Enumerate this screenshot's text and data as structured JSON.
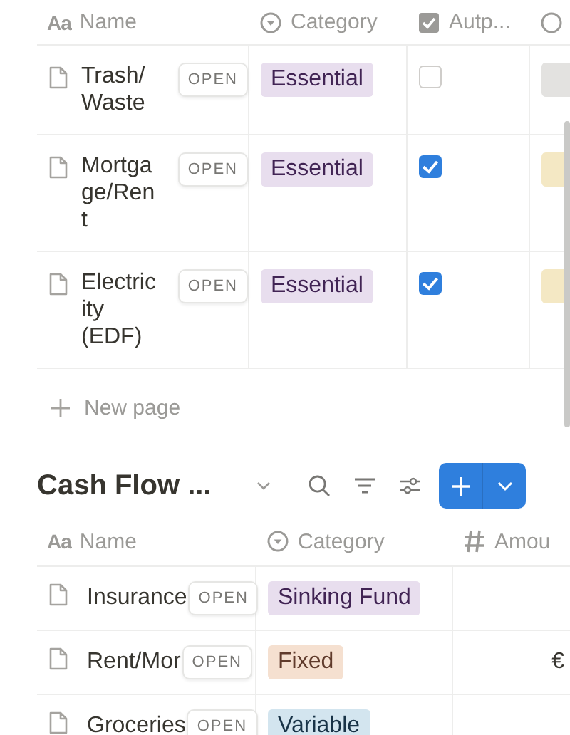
{
  "top_table": {
    "columns": [
      {
        "kind": "title",
        "icon": "Aa",
        "label": "Name"
      },
      {
        "kind": "select",
        "label": "Category"
      },
      {
        "kind": "checkbox",
        "label": "Autp..."
      },
      {
        "kind": "status"
      }
    ],
    "rows": [
      {
        "name": "Trash/ Waste",
        "open": "OPEN",
        "category": {
          "label": "Essential",
          "color": "#e8deee"
        },
        "autopay": false,
        "status": {
          "color": "#e3e2e0"
        }
      },
      {
        "name": "Mortgage/Rent",
        "open": "OPEN",
        "category": {
          "label": "Essential",
          "color": "#e8deee"
        },
        "autopay": true,
        "status": {
          "color": "#f4e8c4"
        }
      },
      {
        "name": "Electricity (EDF)",
        "open": "OPEN",
        "category": {
          "label": "Essential",
          "color": "#e8deee"
        },
        "autopay": true,
        "status": {
          "color": "#f4e8c4"
        }
      }
    ],
    "new_page": "New page"
  },
  "cash_flow": {
    "title": "Cash Flow ...",
    "columns": [
      {
        "kind": "title",
        "icon": "Aa",
        "label": "Name"
      },
      {
        "kind": "select",
        "label": "Category"
      },
      {
        "kind": "number",
        "label": "Amou"
      }
    ],
    "rows": [
      {
        "name": "Insurance",
        "open": "OPEN",
        "category": {
          "label": "Sinking Fund",
          "color": "#e8deee"
        }
      },
      {
        "name": "Rent/Mor",
        "open": "OPEN",
        "category": {
          "label": "Fixed",
          "color": "#f5e0d0"
        },
        "amount": "€"
      },
      {
        "name": "Groceries",
        "open": "OPEN",
        "category": {
          "label": "Variable",
          "color": "#d3e5ef"
        }
      }
    ]
  }
}
